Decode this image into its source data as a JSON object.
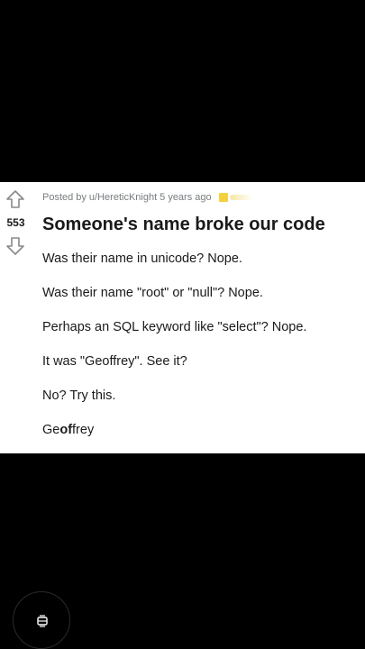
{
  "post": {
    "score": "553",
    "meta_prefix": "Posted by",
    "author": "u/HereticKnight",
    "age": "5 years ago",
    "title": "Someone's name broke our code",
    "body": [
      "Was their name in unicode? Nope.",
      "Was their name \"root\" or \"null\"? Nope.",
      "Perhaps an SQL keyword like \"select\"? Nope.",
      "It was \"Geoffrey\". See it?",
      "No? Try this."
    ],
    "name_parts": {
      "start": "Ge",
      "bold": "of",
      "end": "frey"
    }
  },
  "icons": {
    "upvote": "arrow-up-outline-icon",
    "downvote": "arrow-down-outline-icon",
    "award": "award-icon",
    "fab": "screen-rotate-icon"
  },
  "colors": {
    "background": "#000000",
    "card": "#ffffff",
    "text": "#1a1a1b",
    "meta": "#787c7e",
    "award": "#f4d03f"
  }
}
